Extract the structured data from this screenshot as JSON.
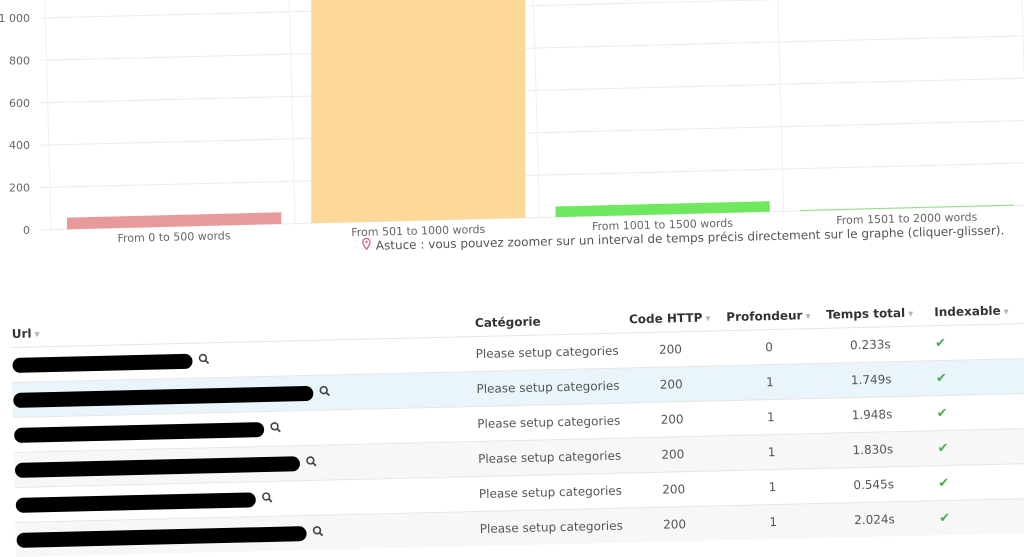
{
  "chart_data": {
    "type": "bar",
    "categories": [
      "From 0 to 500 words",
      "From 501 to 1000 words",
      "From 1001 to 1500 words",
      "From 1501 to 2000 words"
    ],
    "values": [
      55,
      1150,
      50,
      5
    ],
    "colors": [
      "#e89a9a",
      "#fcd899",
      "#6fe85f",
      "#8fdf88"
    ],
    "yticks": [
      "0",
      "200",
      "400",
      "600",
      "800",
      "1 000"
    ],
    "ylim": [
      0,
      1000
    ],
    "grid": true
  },
  "tip": {
    "icon": "pin-icon",
    "text": "Astuce : vous pouvez zoomer sur un interval de temps précis directement sur le graphe (cliquer-glisser)."
  },
  "table": {
    "headers": {
      "url": "Url",
      "category": "Catégorie",
      "code": "Code HTTP",
      "depth": "Profondeur",
      "time": "Temps total",
      "indexable": "Indexable"
    },
    "rows": [
      {
        "redact": 180,
        "category": "Please setup categories",
        "code": "200",
        "depth": "0",
        "time": "0.233s"
      },
      {
        "redact": 300,
        "category": "Please setup categories",
        "code": "200",
        "depth": "1",
        "time": "1.749s"
      },
      {
        "redact": 250,
        "category": "Please setup categories",
        "code": "200",
        "depth": "1",
        "time": "1.948s"
      },
      {
        "redact": 285,
        "category": "Please setup categories",
        "code": "200",
        "depth": "1",
        "time": "1.830s"
      },
      {
        "redact": 240,
        "category": "Please setup categories",
        "code": "200",
        "depth": "1",
        "time": "0.545s"
      },
      {
        "redact": 290,
        "category": "Please setup categories",
        "code": "200",
        "depth": "1",
        "time": "2.024s"
      }
    ],
    "check_glyph": "✔"
  }
}
